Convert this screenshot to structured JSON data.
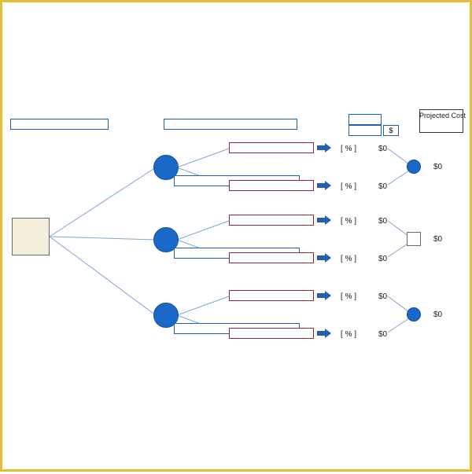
{
  "header": {
    "projected_cost_label": "Projected Cost",
    "dollar_sign": "$"
  },
  "tree": {
    "branches": [
      {
        "outcomes": [
          {
            "pct": "%",
            "cost": "$0"
          },
          {
            "pct": "%",
            "cost": "$0"
          }
        ],
        "projected": "$0",
        "terminal_shape": "circle"
      },
      {
        "outcomes": [
          {
            "pct": "%",
            "cost": "$0"
          },
          {
            "pct": "%",
            "cost": "$0"
          }
        ],
        "projected": "$0",
        "terminal_shape": "square"
      },
      {
        "outcomes": [
          {
            "pct": "%",
            "cost": "$0"
          },
          {
            "pct": "%",
            "cost": "$0"
          }
        ],
        "projected": "$0",
        "terminal_shape": "circle"
      }
    ]
  }
}
